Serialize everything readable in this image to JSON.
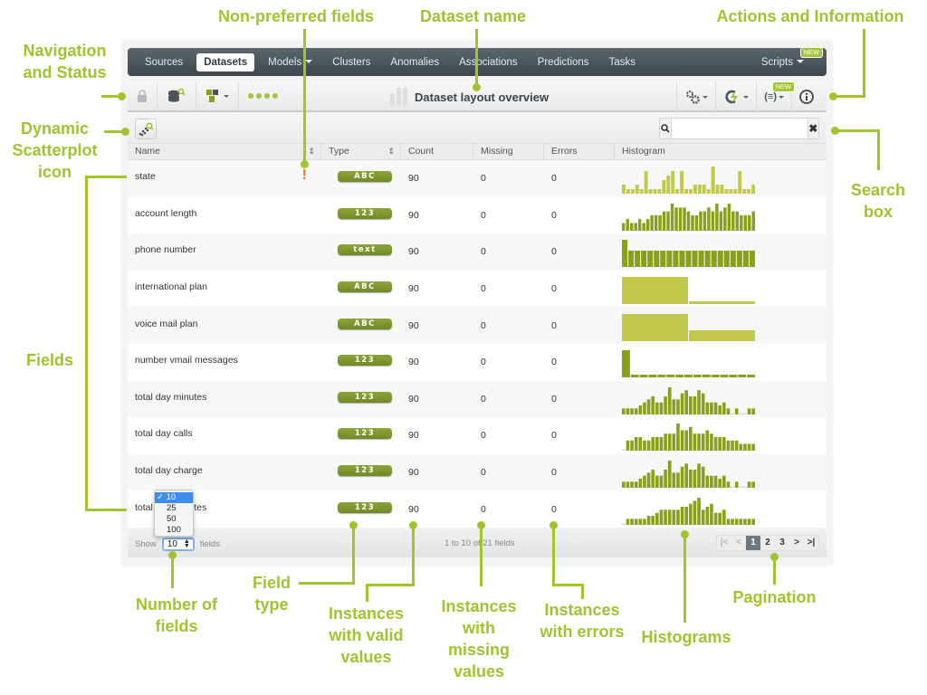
{
  "nav": {
    "items": [
      {
        "label": "Sources",
        "active": false,
        "caret": false
      },
      {
        "label": "Datasets",
        "active": true,
        "caret": false
      },
      {
        "label": "Models",
        "active": false,
        "caret": true
      },
      {
        "label": "Clusters",
        "active": false,
        "caret": false
      },
      {
        "label": "Anomalies",
        "active": false,
        "caret": false
      },
      {
        "label": "Associations",
        "active": false,
        "caret": false
      },
      {
        "label": "Predictions",
        "active": false,
        "caret": false
      },
      {
        "label": "Tasks",
        "active": false,
        "caret": false
      }
    ],
    "scripts_label": "Scripts",
    "new_badge": "NEW"
  },
  "toolbar": {
    "title": "Dataset layout overview",
    "icons_left": [
      "lock-icon",
      "dataset-search-icon",
      "field-types-icon",
      "progress-dots-icon"
    ],
    "icons_right": [
      "configure-gears-icon",
      "one-click-model-icon",
      "filter-expression-icon",
      "info-icon"
    ],
    "new_badge": "NEW"
  },
  "search": {
    "placeholder": "",
    "value": "",
    "clear_label": "✖"
  },
  "table": {
    "columns": [
      "Name",
      "Type",
      "Count",
      "Missing",
      "Errors",
      "Histogram"
    ],
    "rows": [
      {
        "name": "state",
        "type": "ABC",
        "count": "90",
        "missing": "0",
        "errors": "0",
        "non_preferred": true,
        "hist": [
          2,
          1,
          1,
          2,
          1,
          5,
          1,
          1,
          1,
          3,
          4,
          5,
          1,
          5,
          1,
          1,
          2,
          2,
          2,
          1,
          6,
          2,
          2,
          1,
          1,
          1,
          5,
          1,
          1,
          2
        ],
        "hist_color": "#c0c94a"
      },
      {
        "name": "account length",
        "type": "123",
        "count": "90",
        "missing": "0",
        "errors": "0",
        "non_preferred": false,
        "hist": [
          2,
          3,
          2,
          2,
          3,
          2,
          3,
          4,
          4,
          4,
          5,
          5,
          7,
          6,
          6,
          6,
          5,
          4,
          4,
          5,
          5,
          6,
          5,
          7,
          5,
          6,
          7,
          5,
          5,
          4,
          4,
          4,
          5
        ],
        "hist_color": "#8aa01c"
      },
      {
        "name": "phone number",
        "type": "text",
        "count": "90",
        "missing": "0",
        "errors": "0",
        "non_preferred": false,
        "hist": [
          5,
          3,
          3,
          3,
          3,
          3,
          3,
          3,
          3,
          3,
          3,
          3,
          3,
          3,
          3,
          3,
          3,
          3,
          3,
          3,
          3
        ],
        "hist_color": "#8aa01c"
      },
      {
        "name": "international plan",
        "type": "ABC",
        "count": "90",
        "missing": "0",
        "errors": "0",
        "non_preferred": false,
        "hist": [
          30,
          3
        ],
        "hist_color": "#c0c94a"
      },
      {
        "name": "voice mail plan",
        "type": "ABC",
        "count": "90",
        "missing": "0",
        "errors": "0",
        "non_preferred": false,
        "hist": [
          30,
          12
        ],
        "hist_color": "#c0c94a"
      },
      {
        "name": "number vmail messages",
        "type": "123",
        "count": "90",
        "missing": "0",
        "errors": "0",
        "non_preferred": false,
        "hist": [
          30,
          3,
          3,
          3,
          3,
          3,
          3,
          3,
          3,
          3,
          3,
          3,
          3,
          3,
          3
        ],
        "hist_color": "#8aa01c"
      },
      {
        "name": "total day minutes",
        "type": "123",
        "count": "90",
        "missing": "0",
        "errors": "0",
        "non_preferred": false,
        "hist": [
          2,
          2,
          2,
          2,
          3,
          4,
          5,
          6,
          4,
          4,
          6,
          9,
          5,
          5,
          7,
          8,
          6,
          6,
          8,
          7,
          4,
          4,
          4,
          3,
          4,
          2,
          0.5,
          2,
          0.5,
          0.5,
          2,
          2
        ],
        "hist_color": "#8aa01c"
      },
      {
        "name": "total day calls",
        "type": "123",
        "count": "90",
        "missing": "0",
        "errors": "0",
        "non_preferred": false,
        "hist": [
          0.5,
          3,
          3,
          4,
          4,
          3,
          3,
          4,
          4,
          4,
          5,
          5,
          5,
          8,
          6,
          6,
          7,
          5,
          5,
          5,
          6,
          5,
          4,
          4,
          4,
          3,
          3,
          3,
          2,
          2,
          2,
          2
        ],
        "hist_color": "#8aa01c"
      },
      {
        "name": "total day charge",
        "type": "123",
        "count": "90",
        "missing": "0",
        "errors": "0",
        "non_preferred": false,
        "hist": [
          2,
          2,
          2,
          2,
          3,
          4,
          5,
          6,
          4,
          4,
          6,
          9,
          5,
          5,
          7,
          8,
          6,
          6,
          8,
          7,
          4,
          4,
          4,
          3,
          4,
          2,
          0.5,
          2,
          0.5,
          0.5,
          2,
          2
        ],
        "hist_color": "#8aa01c"
      },
      {
        "name": "total eve minutes",
        "type": "123",
        "count": "90",
        "missing": "0",
        "errors": "0",
        "non_preferred": false,
        "hist": [
          0.5,
          2,
          2,
          2,
          2,
          2,
          3,
          3,
          4,
          5,
          5,
          5,
          5,
          5,
          6,
          6,
          7,
          8,
          9,
          5,
          6,
          7,
          4,
          4,
          5,
          2,
          2,
          2,
          2,
          2,
          2,
          2
        ],
        "hist_color": "#8aa01c"
      }
    ]
  },
  "footer": {
    "show_label": "Show",
    "show_value": "10",
    "fields_label": "fields",
    "info": "1 to 10 of 21 fields",
    "pages": [
      "1",
      "2",
      "3"
    ],
    "current_page": "1",
    "first_icon": "first-page-icon",
    "prev_icon": "prev-page-icon",
    "next_icon": "next-page-icon",
    "last_icon": "last-page-icon"
  },
  "dropdown": {
    "options": [
      "10",
      "25",
      "50",
      "100"
    ],
    "selected": "10",
    "check": "✓"
  },
  "annotations": {
    "navigation": "Navigation and Status",
    "scatterplot": "Dynamic Scatterplot icon",
    "fields": "Fields",
    "non_preferred": "Non-preferred fields",
    "dataset_name": "Dataset name",
    "actions": "Actions and Information",
    "search": "Search box",
    "number_of_fields": "Number of fields",
    "field_type": "Field type",
    "valid": "Instances with valid values",
    "missing": "Instances with missing values",
    "errors": "Instances with errors",
    "histograms": "Histograms",
    "pagination": "Pagination"
  },
  "colors": {
    "accent": "#a0c32e",
    "pill": "#7a9329",
    "nav_bg": "#4a555b",
    "warning": "#e07b22",
    "page_active": "#6f7a80"
  }
}
